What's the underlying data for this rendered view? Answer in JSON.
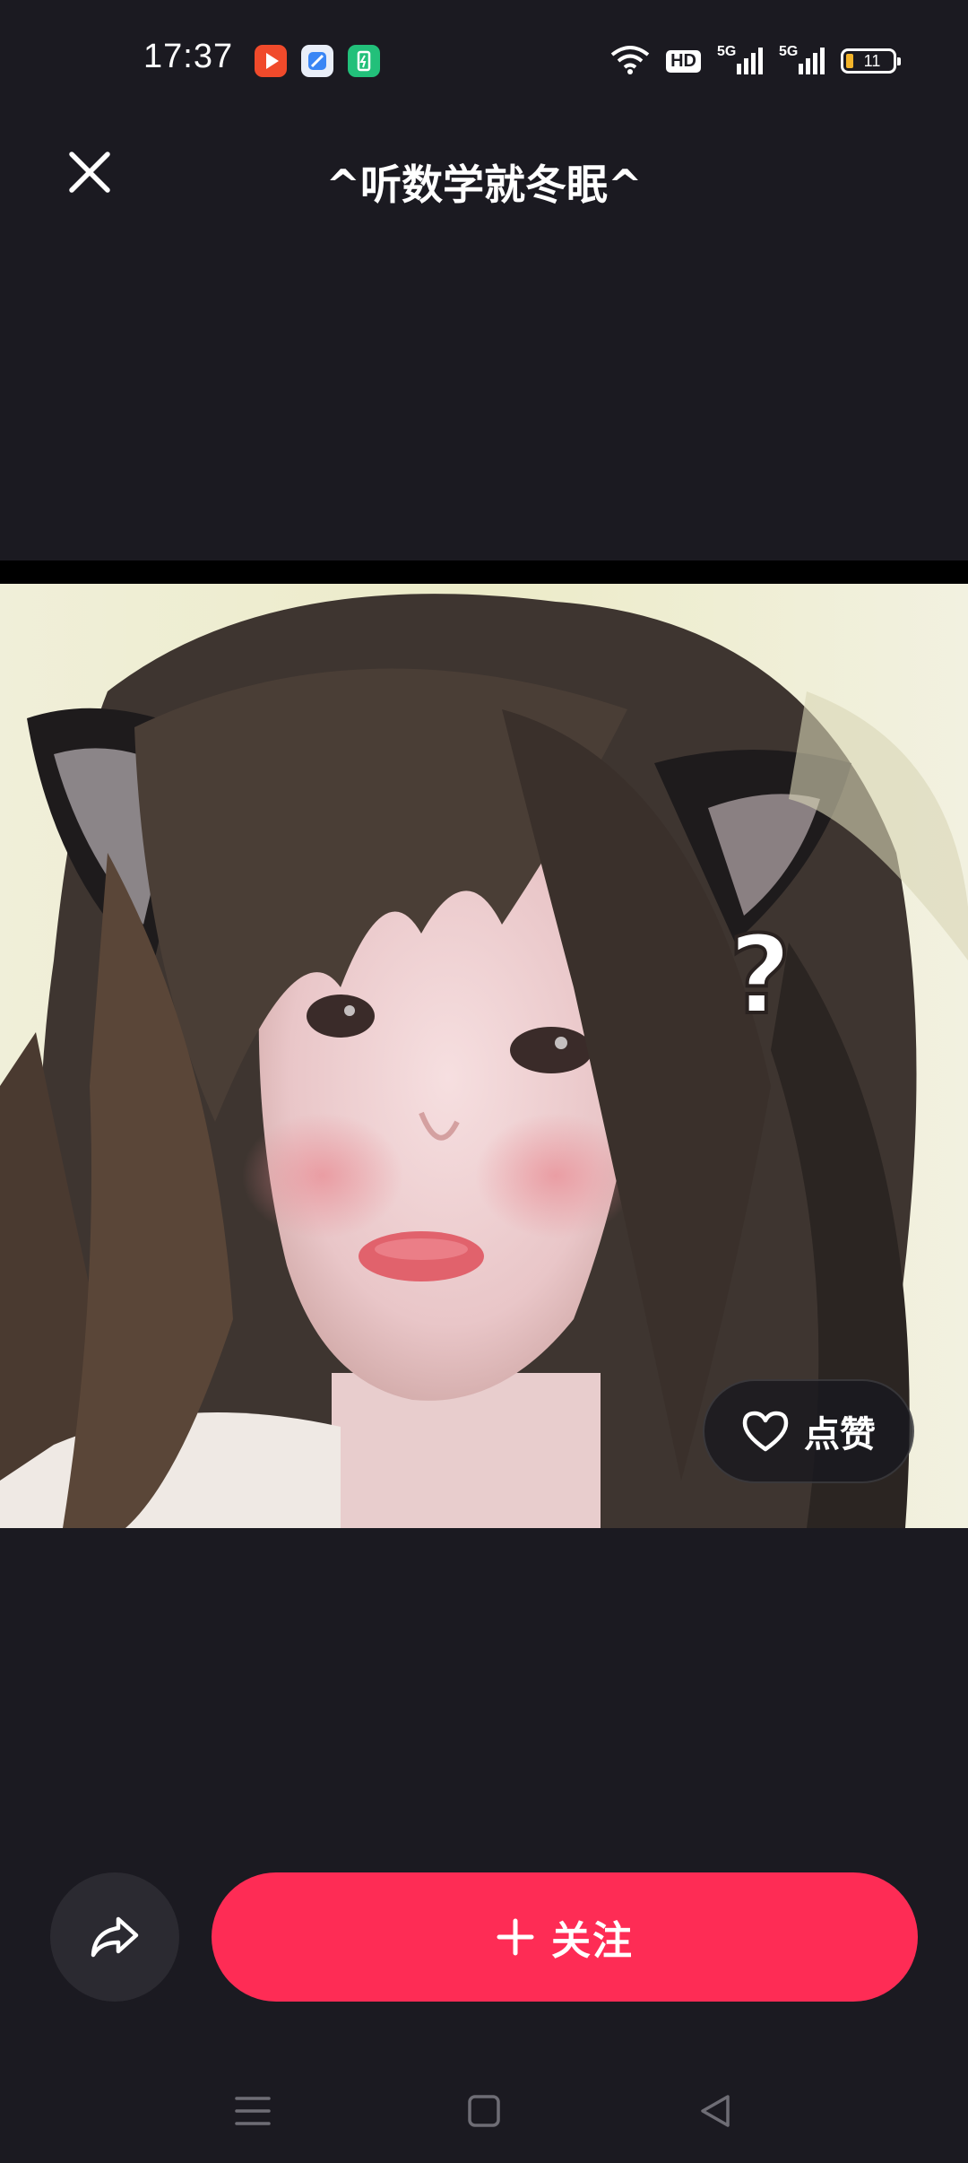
{
  "status_bar": {
    "time": "17:37",
    "hd_label": "HD",
    "network_1": "5G",
    "network_2": "5G",
    "battery_level": "11",
    "battery_color": "#f3b42a"
  },
  "header": {
    "title": "^听数学就冬眠^",
    "close_icon": "close-icon"
  },
  "photo": {
    "overlay_text": "?"
  },
  "like_button": {
    "label": "点赞",
    "icon": "heart-outline-icon"
  },
  "actions": {
    "share_icon": "share-icon",
    "follow_label": "关注",
    "follow_icon": "plus-icon",
    "follow_color": "#fe2c55"
  },
  "system_nav": {
    "menu_icon": "menu-icon",
    "home_icon": "home-square-icon",
    "back_icon": "back-triangle-icon"
  }
}
